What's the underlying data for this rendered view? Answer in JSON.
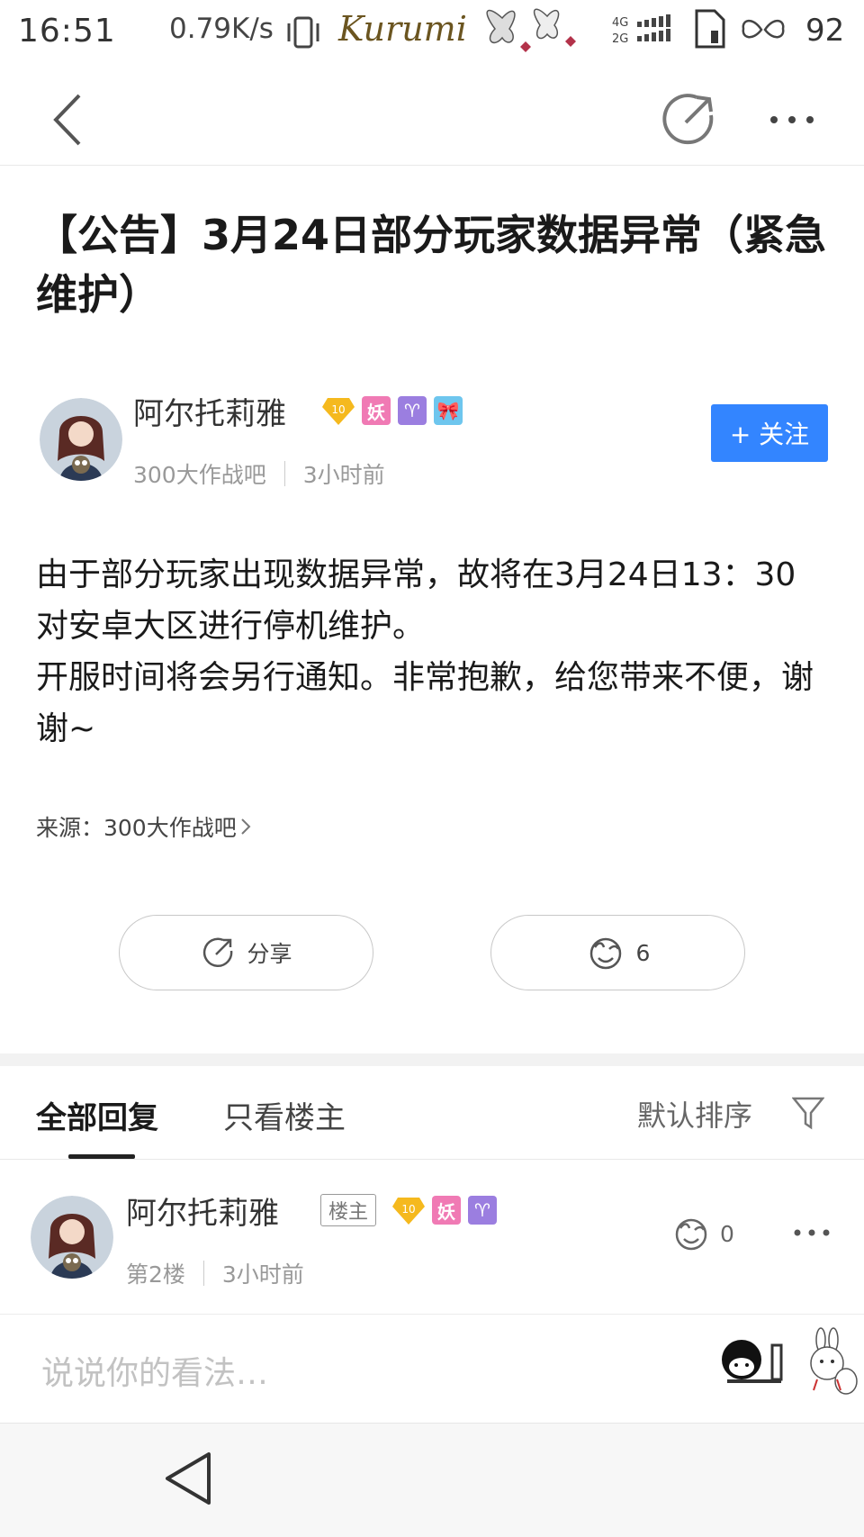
{
  "status_bar": {
    "time": "16:51",
    "speed": "0.79K/s",
    "brand": "Kurumi",
    "network_top": "4G",
    "network_bottom": "2G",
    "battery": "92"
  },
  "post": {
    "title": "【公告】3月24日部分玩家数据异常（紧急维护）",
    "author": {
      "name": "阿尔托莉雅",
      "level": "10",
      "tags": [
        "妖",
        "♈",
        "🎀"
      ],
      "forum": "300大作战吧",
      "time": "3小时前",
      "follow_label": "+ 关注"
    },
    "content": [
      "由于部分玩家出现数据异常，故将在3月24日13：30对安卓大区进行停机维护。",
      "开服时间将会另行通知。非常抱歉，给您带来不便，谢谢~"
    ],
    "source_label": "来源：300大作战吧",
    "share_label": "分享",
    "like_count": "6"
  },
  "reply_tabs": {
    "all_label": "全部回复",
    "op_only_label": "只看楼主",
    "sort_label": "默认排序"
  },
  "reply": {
    "name": "阿尔托莉雅",
    "op_tag": "楼主",
    "level": "10",
    "tags": [
      "妖",
      "♈"
    ],
    "floor": "第2楼",
    "time": "3小时前",
    "like_count": "0"
  },
  "comment_input": {
    "placeholder": "说说你的看法…"
  },
  "colors": {
    "accent": "#3385ff",
    "tag_yao": "#f07ab4",
    "tag_aries": "#9b7ee0",
    "tag_bow": "#6ec6ee",
    "level_badge": "#f5b91e"
  }
}
